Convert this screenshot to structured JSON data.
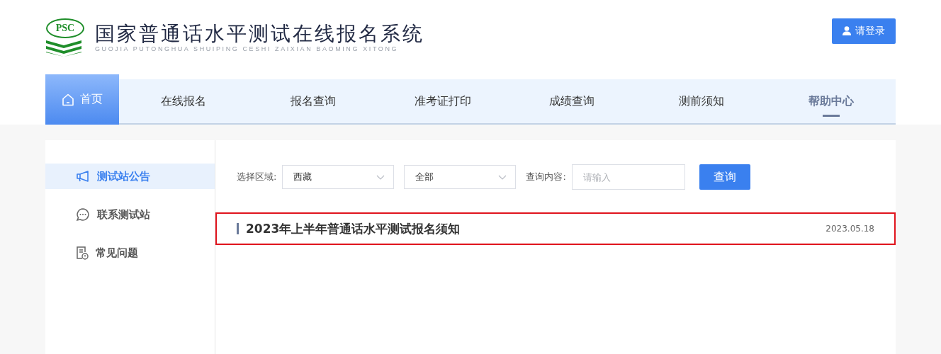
{
  "header": {
    "logo_badge": "PSC",
    "title": "国家普通话水平测试在线报名系统",
    "subtitle": "GUOJIA PUTONGHUA SHUIPING CESHI ZAIXIAN BAOMING XITONG",
    "login_button": "请登录"
  },
  "nav": [
    {
      "label": "首页",
      "selected": true,
      "underlined": false
    },
    {
      "label": "在线报名",
      "selected": false,
      "underlined": false
    },
    {
      "label": "报名查询",
      "selected": false,
      "underlined": false
    },
    {
      "label": "准考证打印",
      "selected": false,
      "underlined": false
    },
    {
      "label": "成绩查询",
      "selected": false,
      "underlined": false
    },
    {
      "label": "测前须知",
      "selected": false,
      "underlined": false
    },
    {
      "label": "帮助中心",
      "selected": false,
      "underlined": true
    }
  ],
  "sidebar": [
    {
      "label": "测试站公告",
      "kind": "megaphone",
      "selected": true
    },
    {
      "label": "联系测试站",
      "kind": "chat",
      "selected": false
    },
    {
      "label": "常见问题",
      "kind": "document",
      "selected": false
    }
  ],
  "filters": {
    "region_label": "选择区域:",
    "region": "西藏",
    "scope": "全部",
    "query_label": "查询内容:",
    "query_placeholder": "请输入",
    "search_button": "查询"
  },
  "notices": [
    {
      "title": "2023年上半年普通话水平测试报名须知",
      "date": "2023.05.18",
      "highlighted": true
    }
  ]
}
